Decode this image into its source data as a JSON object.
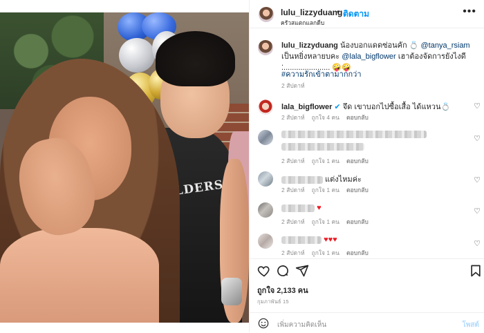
{
  "header": {
    "username": "lulu_lizzyduang",
    "dot": "•",
    "follow": "ติดตาม",
    "subtitle": "ครัวสแตกแลกดีบ",
    "more": "•••"
  },
  "caption": {
    "username": "lulu_lizzyduang",
    "text_a": " น้องบอกแดดซ่อนคัก 💍 ",
    "mention1": "@tanya_rsiam",
    "text_b": " เป็นหยิ่งหลายบคะ ",
    "mention2": "@lala_bigflower",
    "text_c": " เฮาต้องจัดการยังไงดี ....................... 🤪🤪",
    "dot": ".",
    "hashtag": "#ความรักเข้าตามากกว่า",
    "time": "2 สัปดาห์"
  },
  "comments": [
    {
      "username": "lala_bigflower",
      "text": " จึด เขาบอกไปซื้อเสื้อ ได้แหวน💍",
      "time": "2 สัปดาห์",
      "likes": "ถูกใจ 4 คน",
      "reply": "ตอบกลับ"
    },
    {
      "username": "",
      "text": "",
      "time": "2 สัปดาห์",
      "likes": "ถูกใจ 1 คน",
      "reply": "ตอบกลับ"
    },
    {
      "username": "",
      "text": " แต่งไหมค่ะ",
      "time": "2 สัปดาห์",
      "likes": "ถูกใจ 1 คน",
      "reply": "ตอบกลับ"
    },
    {
      "username": "",
      "text": "♥",
      "time": "2 สัปดาห์",
      "likes": "ถูกใจ 1 คน",
      "reply": "ตอบกลับ"
    },
    {
      "username": "",
      "text": "♥♥♥",
      "time": "2 สัปดาห์",
      "likes": "ถูกใจ 1 คน",
      "reply": "ตอบกลับ"
    }
  ],
  "footer": {
    "likes": "ถูกใจ 2,133 คน",
    "date": "กุมภาพันธ์ 15",
    "add_placeholder": "เพิ่มความคิดเห็น",
    "post": "โพสต์"
  },
  "photo": {
    "shirt_print": "COLDERS"
  },
  "colors": {
    "link": "#0095f6",
    "mention": "#00376b",
    "heart": "#ed1c24"
  }
}
